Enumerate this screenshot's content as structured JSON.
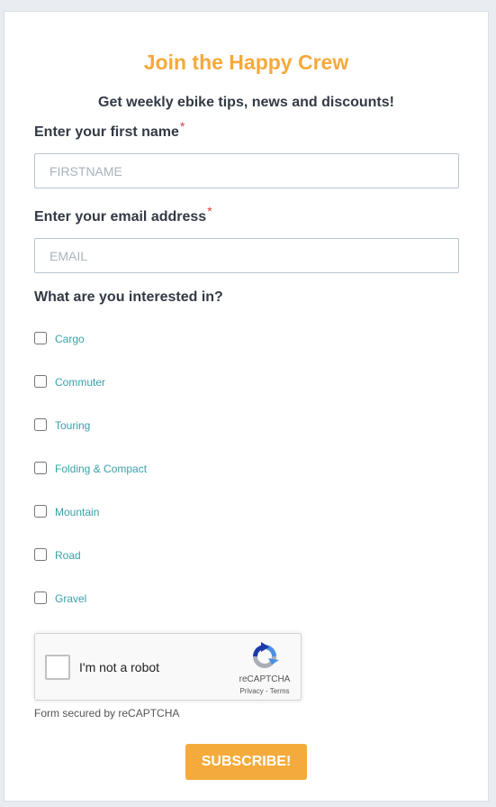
{
  "form": {
    "title": "Join the Happy Crew",
    "subtitle": "Get weekly ebike tips, news and discounts!",
    "first_name_label": "Enter your first name",
    "first_name_placeholder": "FIRSTNAME",
    "email_label": "Enter your email address",
    "email_placeholder": "EMAIL",
    "required_mark": "*",
    "interests_label": "What are you interested in?",
    "interests": [
      {
        "label": "Cargo",
        "checked": false
      },
      {
        "label": "Commuter",
        "checked": false
      },
      {
        "label": "Touring",
        "checked": false
      },
      {
        "label": "Folding & Compact",
        "checked": false
      },
      {
        "label": "Mountain",
        "checked": false
      },
      {
        "label": "Road",
        "checked": false
      },
      {
        "label": "Gravel",
        "checked": false
      }
    ],
    "captcha": {
      "label": "I'm not a robot",
      "brand": "reCAPTCHA",
      "links": "Privacy - Terms",
      "icon": "recaptcha-logo-icon"
    },
    "secured_text": "Form secured by reCAPTCHA",
    "submit_label": "SUBSCRIBE!",
    "colors": {
      "accent": "#f5a93b",
      "link": "#3aa0a8",
      "text": "#333a45"
    }
  }
}
